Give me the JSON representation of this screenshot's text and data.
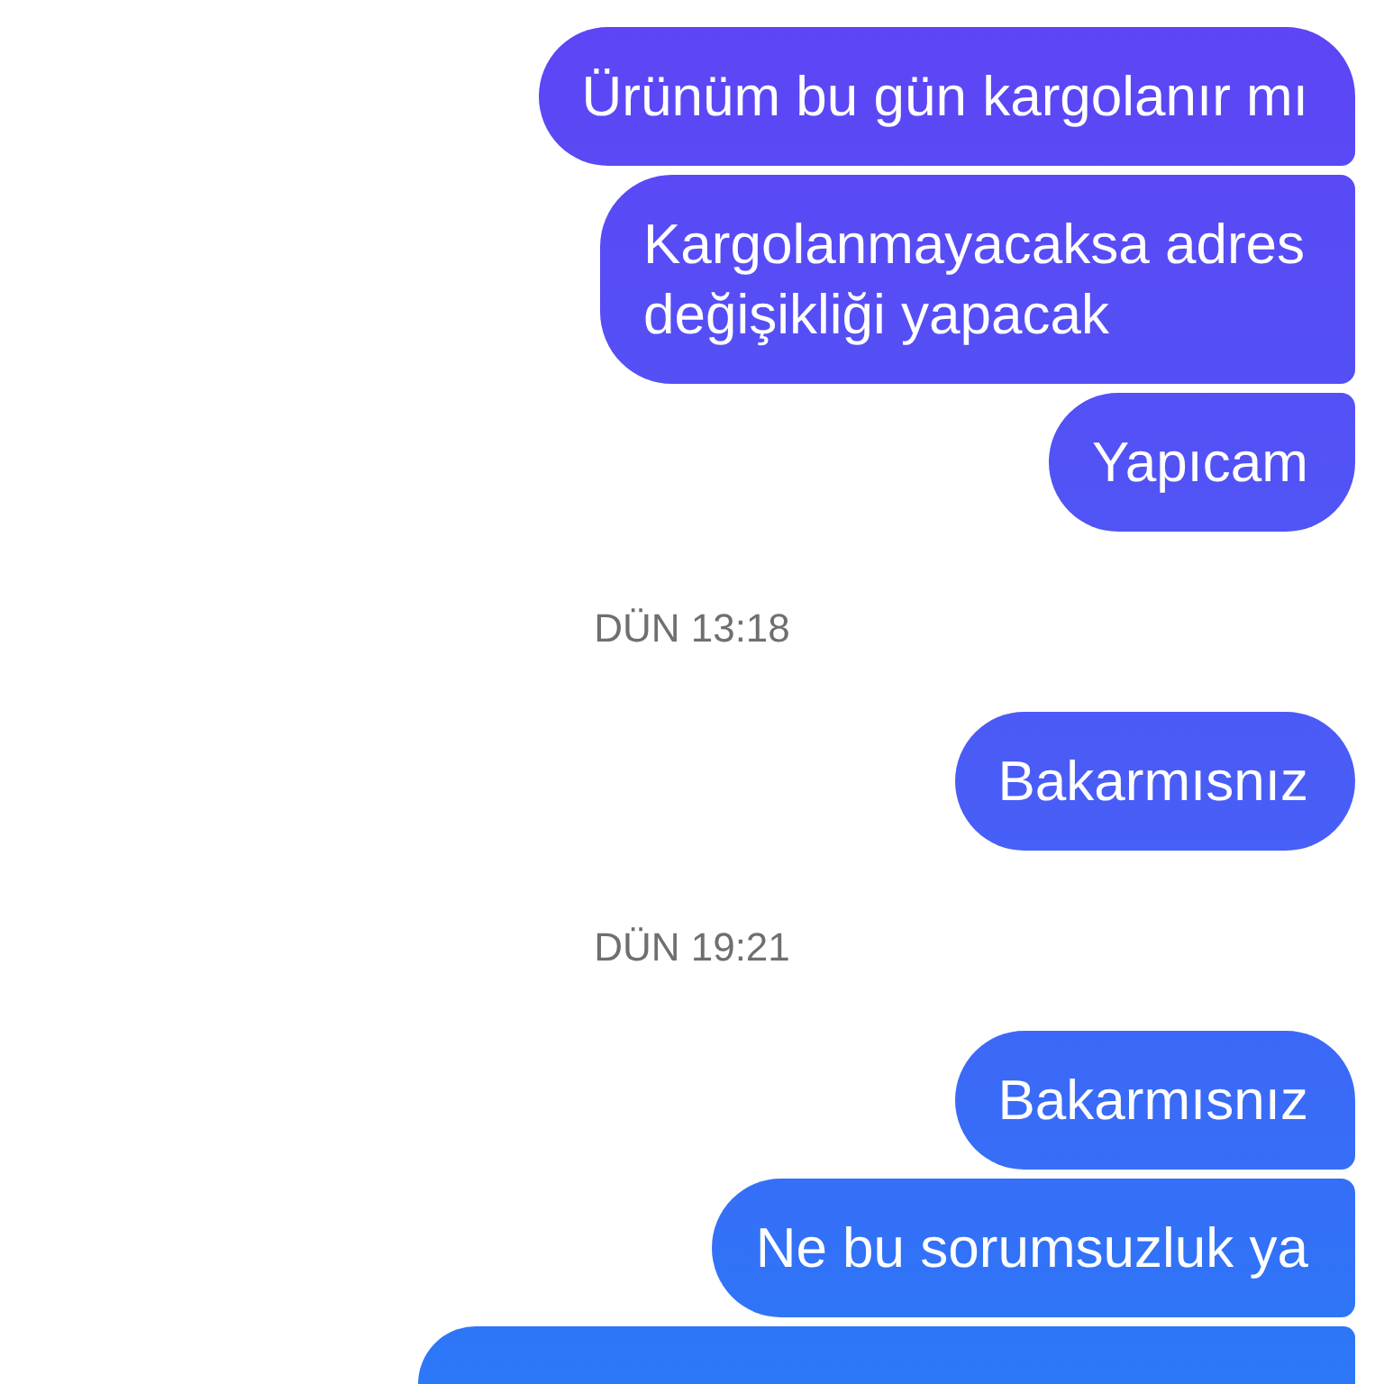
{
  "conversation": [
    {
      "kind": "message",
      "text": "Ürünüm bu gün kargolanır mı"
    },
    {
      "kind": "message",
      "text": "Kargolanmayacaksa adres değişikliği yapacak"
    },
    {
      "kind": "message",
      "text": "Yapıcam"
    },
    {
      "kind": "timestamp",
      "text": "DÜN 13:18"
    },
    {
      "kind": "message",
      "text": "Bakarmısnız"
    },
    {
      "kind": "timestamp",
      "text": "DÜN 19:21"
    },
    {
      "kind": "message",
      "text": "Bakarmısnız"
    },
    {
      "kind": "message",
      "text": "Ne bu sorumsuzluk ya"
    },
    {
      "kind": "message"
    }
  ]
}
